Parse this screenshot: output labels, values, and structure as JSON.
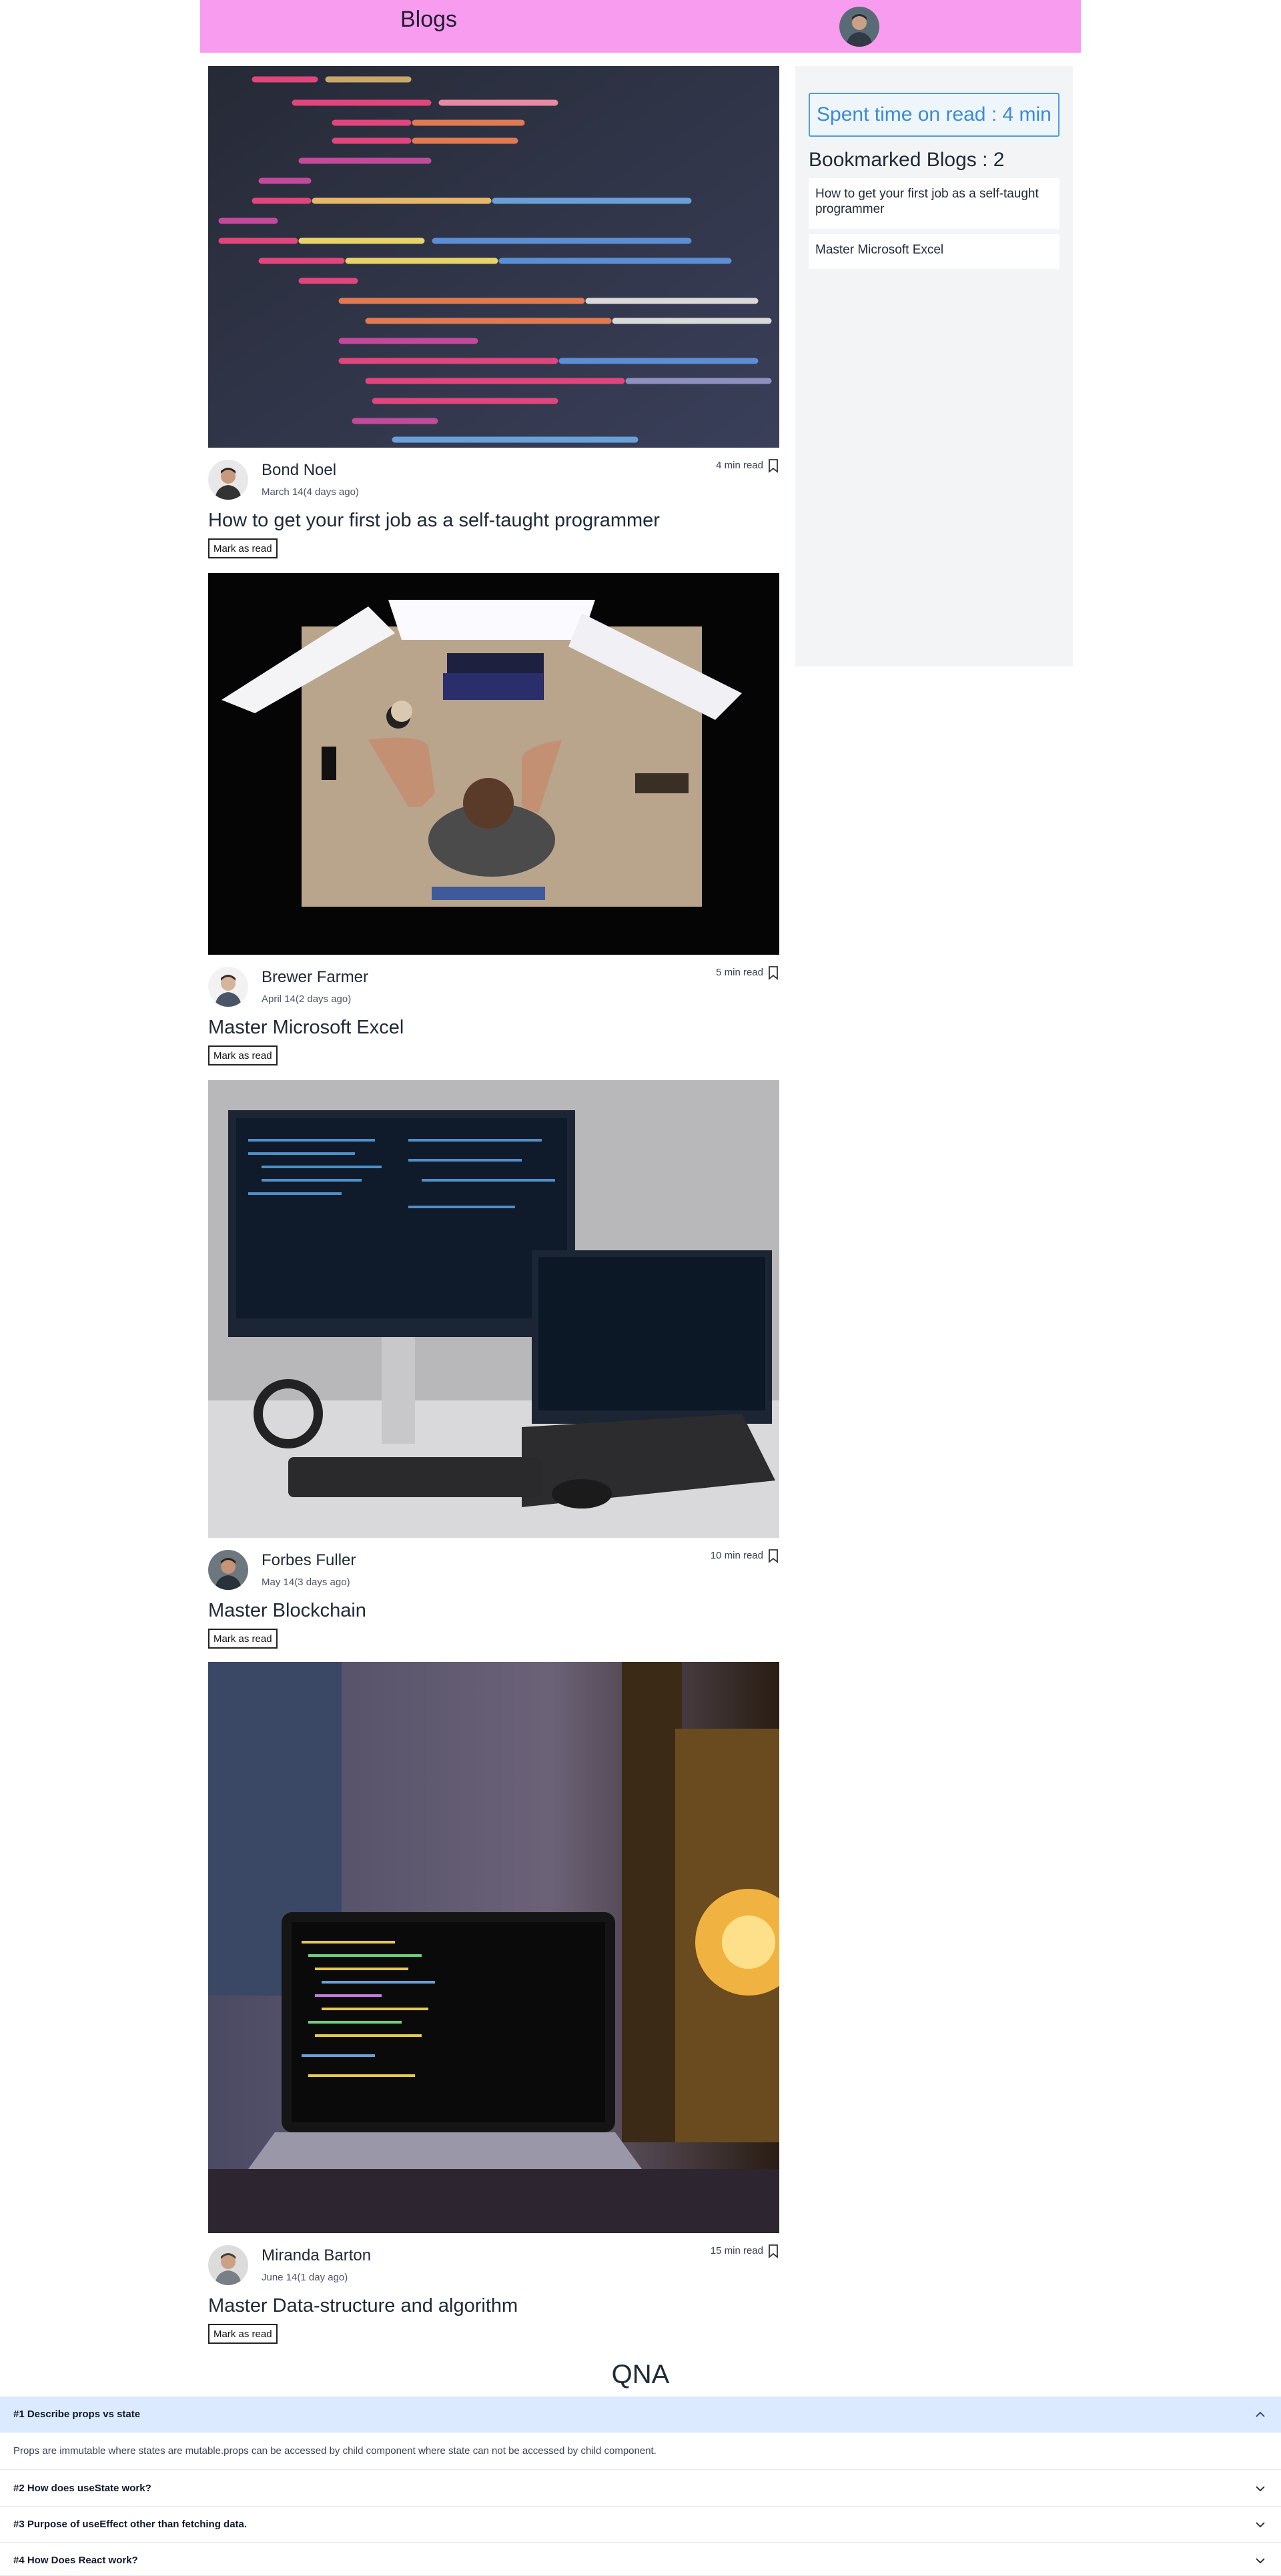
{
  "navbar": {
    "brand": "Blogs",
    "avatar_icon": "user-avatar-icon"
  },
  "blogs": [
    {
      "author": "Bond Noel",
      "date": "March 14(4 days ago)",
      "read_time": "4 min read",
      "title": "How to get your first job as a self-taught programmer",
      "mark_label": "Mark as read",
      "cover_icon": "code-editor-image"
    },
    {
      "author": "Brewer Farmer",
      "date": "April 14(2 days ago)",
      "read_time": "5 min read",
      "title": "Master Microsoft Excel",
      "mark_label": "Mark as read",
      "cover_icon": "desk-setup-image"
    },
    {
      "author": "Forbes Fuller",
      "date": "May 14(3 days ago)",
      "read_time": "10 min read",
      "title": "Master Blockchain",
      "mark_label": "Mark as read",
      "cover_icon": "monitor-laptop-image"
    },
    {
      "author": "Miranda Barton",
      "date": "June 14(1 day ago)",
      "read_time": "15 min read",
      "title": "Master Data-structure and algorithm",
      "mark_label": "Mark as read",
      "cover_icon": "laptop-lamp-image"
    }
  ],
  "sidebar": {
    "spent_time": "Spent time on read : 4 min",
    "bookmarks_heading": "Bookmarked Blogs : 2",
    "bookmarks": [
      "How to get your first job as a self-taught programmer",
      "Master Microsoft Excel"
    ]
  },
  "qna": {
    "title": "QNA",
    "items": [
      {
        "question": "#1 Describe props vs state",
        "answer": "Props are immutable where states are mutable.props can be accessed by child component where state can not be accessed by child component.",
        "expanded": true
      },
      {
        "question": "#2 How does useState work?",
        "expanded": false
      },
      {
        "question": "#3 Purpose of useEffect other than fetching data.",
        "expanded": false
      },
      {
        "question": "#4 How Does React work?",
        "expanded": false
      }
    ]
  },
  "colors": {
    "navbar_bg": "#f89cf0",
    "accent_blue": "#3b8bd6",
    "sidebar_bg": "#f3f4f6",
    "qna_active_bg": "#dbeafe"
  }
}
